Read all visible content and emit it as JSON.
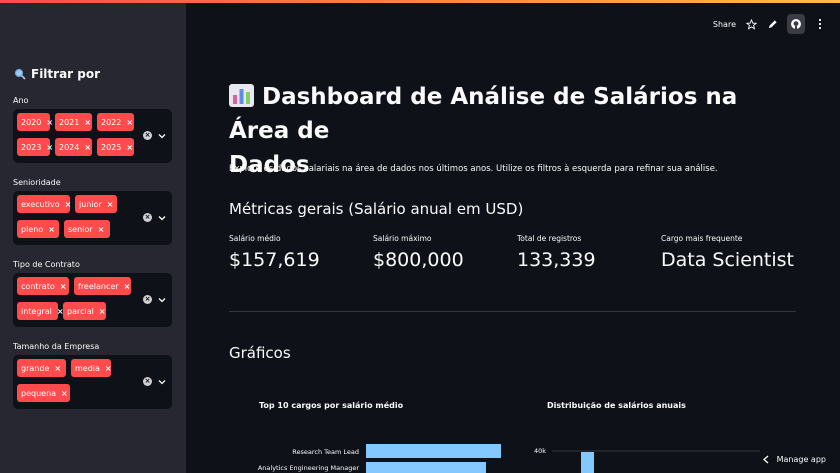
{
  "header": {
    "share_label": "Share",
    "star_icon": "star-icon",
    "edit_icon": "pencil-icon",
    "github_icon": "github-icon",
    "menu_icon": "more-vertical-icon"
  },
  "sidebar": {
    "title": "Filtrar por",
    "filters": [
      {
        "label": "Ano",
        "tags": [
          "2020",
          "2021",
          "2022",
          "2023",
          "2024",
          "2025"
        ]
      },
      {
        "label": "Senioridade",
        "tags": [
          "executivo",
          "junior",
          "pleno",
          "senior"
        ]
      },
      {
        "label": "Tipo de Contrato",
        "tags": [
          "contrato",
          "freelancer",
          "integral",
          "parcial"
        ]
      },
      {
        "label": "Tamanho da Empresa",
        "tags": [
          "grande",
          "media",
          "pequena"
        ]
      }
    ],
    "tag_remove_symbol": "×"
  },
  "main": {
    "title_line1": "Dashboard de Análise de Salários na Área de",
    "title_line2": "Dados",
    "description": "Explore os dados salariais na área de dados nos últimos anos. Utilize os filtros à esquerda para refinar sua análise.",
    "metrics_heading": "Métricas gerais (Salário anual em USD)",
    "metrics": [
      {
        "label": "Salário médio",
        "value": "$157,619"
      },
      {
        "label": "Salário máximo",
        "value": "$800,000"
      },
      {
        "label": "Total de registros",
        "value": "133,339"
      },
      {
        "label": "Cargo mais frequente",
        "value": "Data Scientist"
      }
    ],
    "charts_heading": "Gráficos"
  },
  "chart_data": [
    {
      "type": "bar",
      "title": "Top 10 cargos por salário médio",
      "orientation": "horizontal",
      "categories": [
        "Research Team Lead",
        "Analytics Engineering Manager"
      ],
      "values": [
        null,
        null
      ]
    },
    {
      "type": "bar",
      "title": "Distribuição de salários anuais",
      "y_tick_labels": [
        "40k"
      ]
    }
  ],
  "footer": {
    "manage_label": "Manage app"
  },
  "colors": {
    "accent": "#ff4b4b",
    "bar": "#83c9ff",
    "background": "#0e1117",
    "sidebar": "#262730"
  }
}
